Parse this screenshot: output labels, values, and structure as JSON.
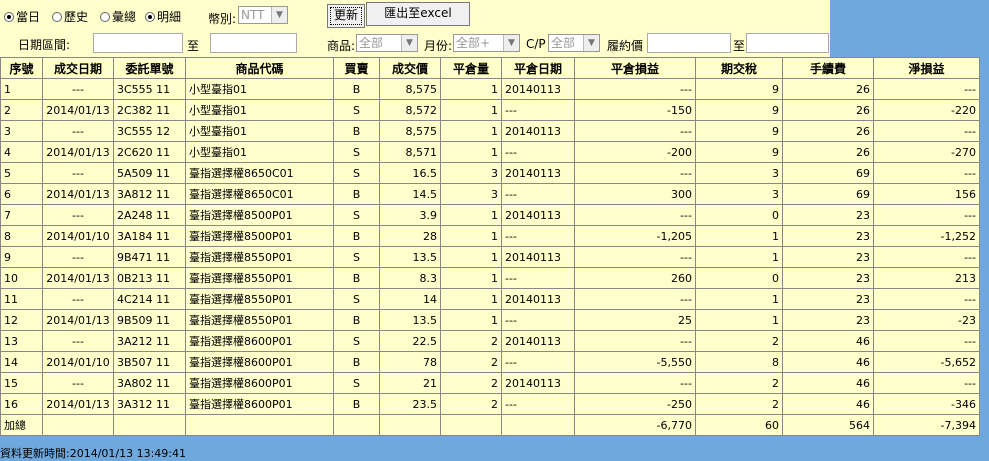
{
  "filters": {
    "radios": [
      {
        "label": "當日",
        "checked": true
      },
      {
        "label": "歷史",
        "checked": false
      },
      {
        "label": "彙總",
        "checked": false
      },
      {
        "label": "明細",
        "checked": true
      }
    ],
    "currency_label": "幣別:",
    "currency_value": "NTT",
    "date_range_label": "日期區間:",
    "to_label": "至",
    "product_label": "商品:",
    "product_value": "全部",
    "month_label": "月份:",
    "month_value": "全部+",
    "cp_label": "C/P",
    "cp_value": "全部",
    "strike_label": "履約價",
    "strike_to_label": "至",
    "refresh_label": "更新",
    "export_label": "匯出至excel"
  },
  "table": {
    "headers": [
      "序號",
      "成交日期",
      "委託單號",
      "商品代碼",
      "買賣",
      "成交價",
      "平倉量",
      "平倉日期",
      "平倉損益",
      "期交稅",
      "手續費",
      "淨損益"
    ],
    "rows": [
      [
        "1",
        "---",
        "3C555 11",
        "小型臺指01",
        "B",
        "8,575",
        "1",
        "20140113",
        "---",
        "9",
        "26",
        "---"
      ],
      [
        "2",
        "2014/01/13",
        "2C382 11",
        "小型臺指01",
        "S",
        "8,572",
        "1",
        "---",
        "-150",
        "9",
        "26",
        "-220"
      ],
      [
        "3",
        "---",
        "3C555 12",
        "小型臺指01",
        "B",
        "8,575",
        "1",
        "20140113",
        "---",
        "9",
        "26",
        "---"
      ],
      [
        "4",
        "2014/01/13",
        "2C620 11",
        "小型臺指01",
        "S",
        "8,571",
        "1",
        "---",
        "-200",
        "9",
        "26",
        "-270"
      ],
      [
        "5",
        "---",
        "5A509 11",
        "臺指選擇權8650C01",
        "S",
        "16.5",
        "3",
        "20140113",
        "---",
        "3",
        "69",
        "---"
      ],
      [
        "6",
        "2014/01/13",
        "3A812 11",
        "臺指選擇權8650C01",
        "B",
        "14.5",
        "3",
        "---",
        "300",
        "3",
        "69",
        "156"
      ],
      [
        "7",
        "---",
        "2A248 11",
        "臺指選擇權8500P01",
        "S",
        "3.9",
        "1",
        "20140113",
        "---",
        "0",
        "23",
        "---"
      ],
      [
        "8",
        "2014/01/10",
        "3A184 11",
        "臺指選擇權8500P01",
        "B",
        "28",
        "1",
        "---",
        "-1,205",
        "1",
        "23",
        "-1,252"
      ],
      [
        "9",
        "---",
        "9B471 11",
        "臺指選擇權8550P01",
        "S",
        "13.5",
        "1",
        "20140113",
        "---",
        "1",
        "23",
        "---"
      ],
      [
        "10",
        "2014/01/13",
        "0B213 11",
        "臺指選擇權8550P01",
        "B",
        "8.3",
        "1",
        "---",
        "260",
        "0",
        "23",
        "213"
      ],
      [
        "11",
        "---",
        "4C214 11",
        "臺指選擇權8550P01",
        "S",
        "14",
        "1",
        "20140113",
        "---",
        "1",
        "23",
        "---"
      ],
      [
        "12",
        "2014/01/13",
        "9B509 11",
        "臺指選擇權8550P01",
        "B",
        "13.5",
        "1",
        "---",
        "25",
        "1",
        "23",
        "-23"
      ],
      [
        "13",
        "---",
        "3A212 11",
        "臺指選擇權8600P01",
        "S",
        "22.5",
        "2",
        "20140113",
        "---",
        "2",
        "46",
        "---"
      ],
      [
        "14",
        "2014/01/10",
        "3B507 11",
        "臺指選擇權8600P01",
        "B",
        "78",
        "2",
        "---",
        "-5,550",
        "8",
        "46",
        "-5,652"
      ],
      [
        "15",
        "---",
        "3A802 11",
        "臺指選擇權8600P01",
        "S",
        "21",
        "2",
        "20140113",
        "---",
        "2",
        "46",
        "---"
      ],
      [
        "16",
        "2014/01/13",
        "3A312 11",
        "臺指選擇權8600P01",
        "B",
        "23.5",
        "2",
        "---",
        "-250",
        "2",
        "46",
        "-346"
      ]
    ],
    "total": {
      "label": "加總",
      "pnl": "-6,770",
      "tax": "60",
      "fee": "564",
      "net": "-7,394"
    }
  },
  "updated_text": "資料更新時間:2014/01/13 13:49:41"
}
